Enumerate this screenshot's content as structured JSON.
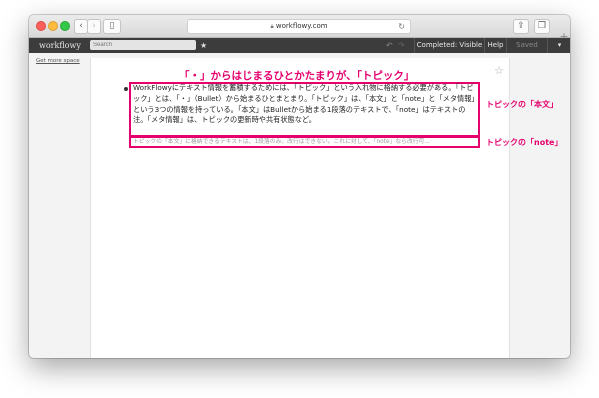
{
  "browser": {
    "url": "workflowy.com",
    "lock_icon": "lock-icon",
    "new_tab": "+"
  },
  "header": {
    "logo": "workflowy",
    "search_placeholder": "Search",
    "completed_label": "Completed: Visible",
    "help_label": "Help",
    "saved_label": "Saved"
  },
  "sidebar": {
    "get_more_space": "Get more space"
  },
  "annotations": {
    "title": "「・」からはじまるひとかたまりが、「トピック」",
    "main_text_label": "トピックの「本文」",
    "note_label": "トピックの「note」"
  },
  "topic": {
    "text": "WorkFlowyにテキスト情報を蓄積するためには、「トピック」という入れ物に格納する必要がある。「トピック」とは、「・」（Bullet）から始まるひとまとまり。「トピック」は、「本文」と「note」と「メタ情報」という3つの情報を持っている。「本文」はBulletから始まる1段落のテキストで、「note」はテキストの注。「メタ情報」は、トピックの更新時や共有状態など。",
    "note": "トピックの「本文」に格納できるテキストは、1段落のみ。改行はできない。これに対して、「note」なら改行可..."
  },
  "colors": {
    "annotation": "#e5006e",
    "header_bg": "#3c3c3c"
  }
}
